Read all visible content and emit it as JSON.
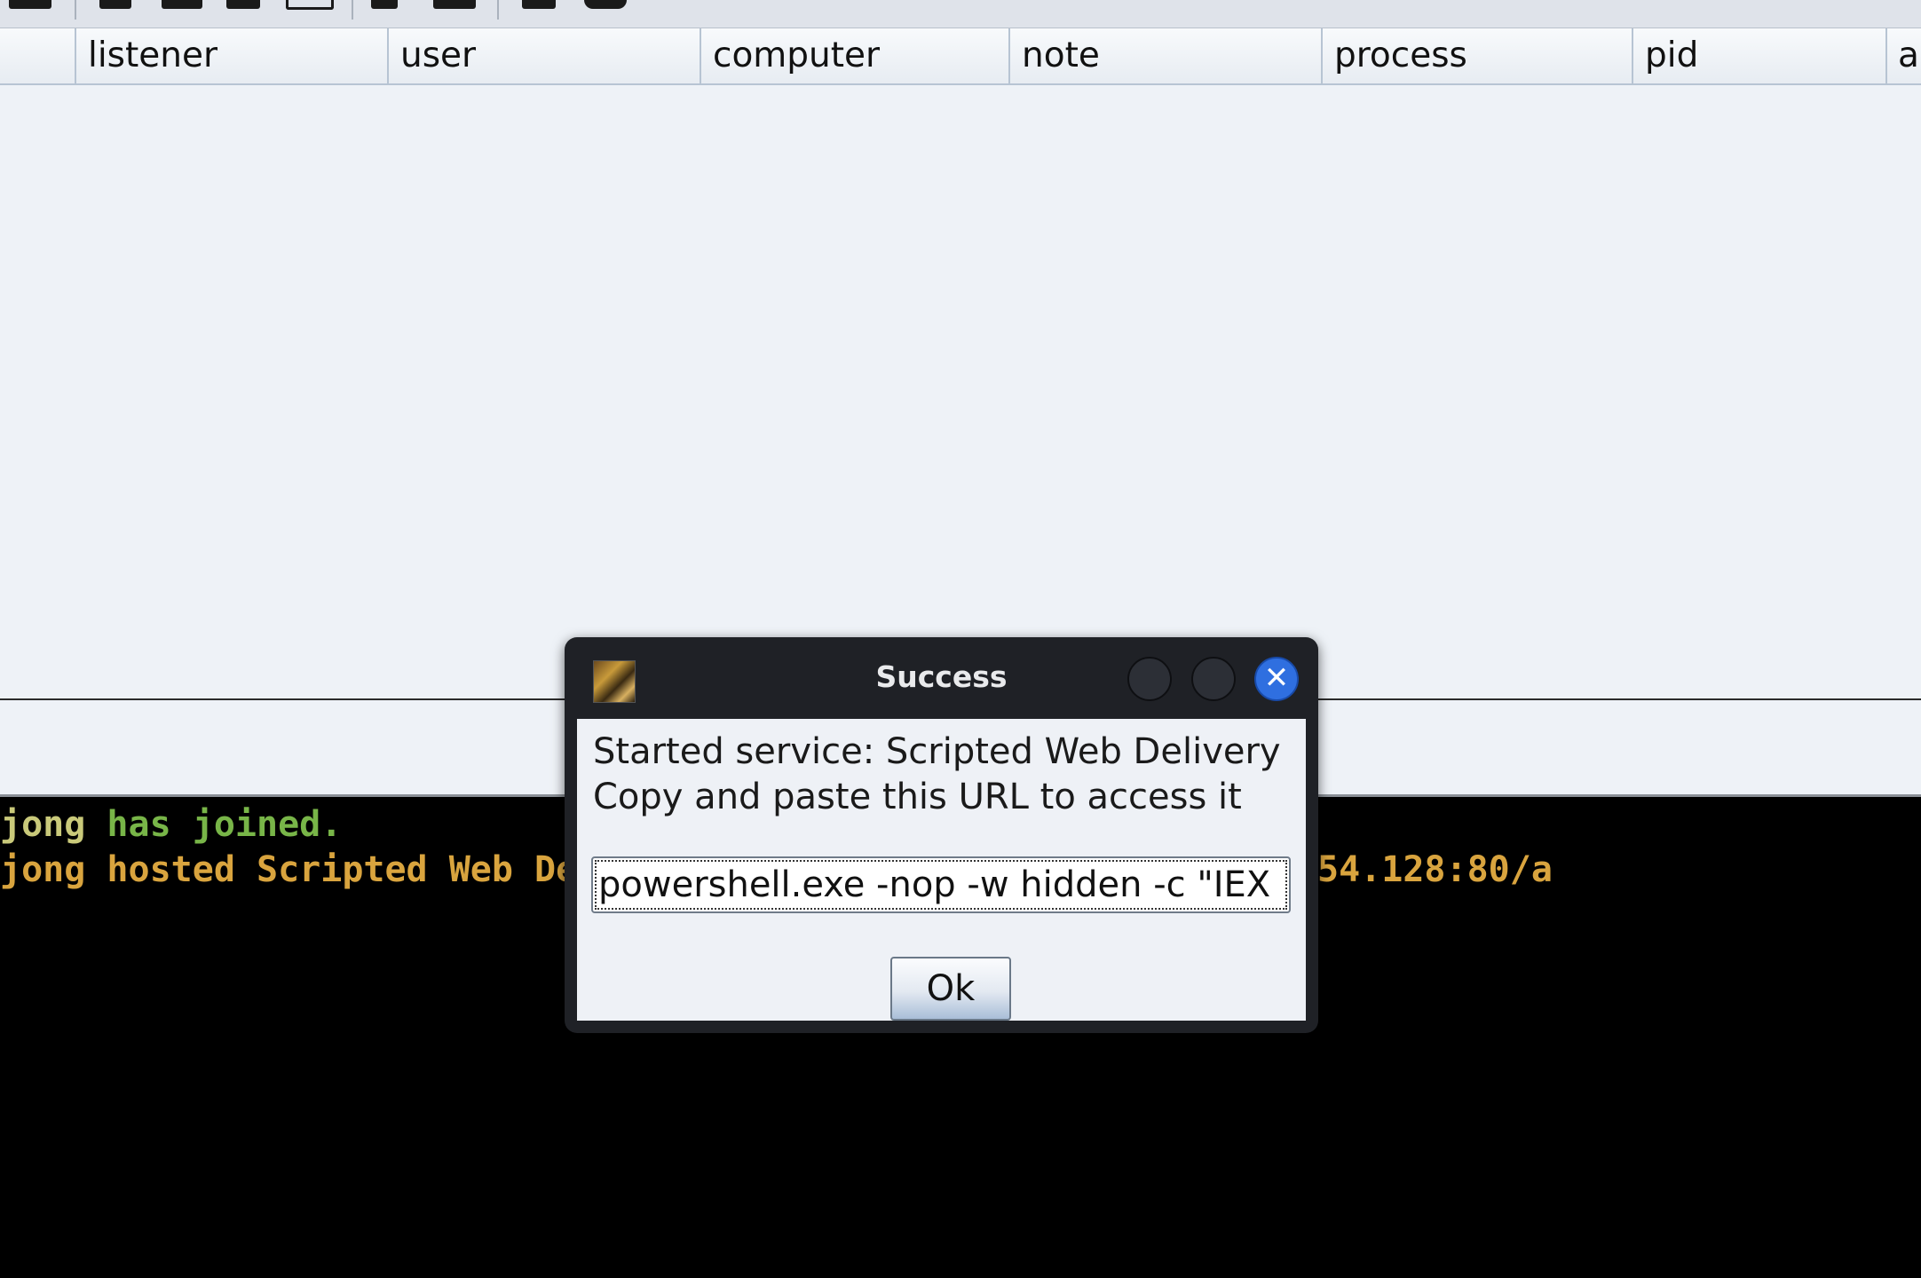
{
  "toolbar": {
    "icons": [
      "toolbar-icon-1",
      "toolbar-icon-2",
      "toolbar-icon-3",
      "toolbar-icon-4",
      "toolbar-icon-5",
      "toolbar-icon-6",
      "toolbar-icon-7",
      "toolbar-icon-8",
      "toolbar-icon-9"
    ]
  },
  "table": {
    "columns": [
      "",
      "listener",
      "user",
      "computer",
      "note",
      "process",
      "pid",
      "a"
    ],
    "rows": []
  },
  "event_log": {
    "line1": {
      "user": "jong",
      "text": " has joined."
    },
    "line2": {
      "text": "jong hosted Scripted Web De"
    },
    "line2_tail": "54.128:80/a"
  },
  "dialog": {
    "title": "Success",
    "message_line1": "Started service: Scripted Web Delivery",
    "message_line2": "Copy and paste this URL to access it",
    "url_value": "powershell.exe -nop -w hidden -c \"IEX",
    "ok_label": "Ok",
    "close_glyph": "✕",
    "app_icon": "app-logo-icon"
  },
  "colors": {
    "log_user": "#c9c97a",
    "log_joined": "#78b548",
    "log_hosted": "#d9a43e",
    "close_button": "#2f6fe0"
  }
}
